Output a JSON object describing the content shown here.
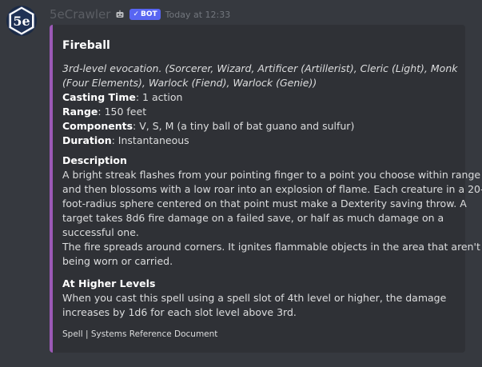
{
  "message": {
    "avatar_alt": "5e",
    "username": "5eCrawler",
    "bot_tag": "BOT",
    "timestamp": "Today at 12:33"
  },
  "embed": {
    "accent_color": "#9b59b6",
    "title": "Fireball",
    "subtitle_lines": [
      "3rd-level evocation. (Sorcerer, Wizard, Artificer (Artillerist), Cleric (Light), Monk",
      "(Four Elements), Warlock (Fiend), Warlock (Genie))"
    ],
    "properties": [
      {
        "label": "Casting Time",
        "value": ": 1 action"
      },
      {
        "label": "Range",
        "value": ": 150 feet"
      },
      {
        "label": "Components",
        "value": ": V, S, M (a tiny ball of bat guano and sulfur)"
      },
      {
        "label": "Duration",
        "value": ": Instantaneous"
      }
    ],
    "fields": [
      {
        "name": "Description",
        "lines": [
          "A bright streak flashes from your pointing finger to a point you choose within range",
          "and then blossoms with a low roar into an explosion of flame. Each creature in a 20-",
          "foot-radius sphere centered on that point must make a Dexterity saving throw. A",
          "target takes 8d6 fire damage on a failed save, or half as much damage on a",
          "successful one.",
          "The fire spreads around corners. It ignites flammable objects in the area that aren't",
          "being worn or carried."
        ]
      },
      {
        "name": "At Higher Levels",
        "lines": [
          "When you cast this spell using a spell slot of 4th level or higher, the damage",
          "increases by 1d6 for each slot level above 3rd."
        ]
      }
    ],
    "footer": "Spell | Systems Reference Document"
  }
}
